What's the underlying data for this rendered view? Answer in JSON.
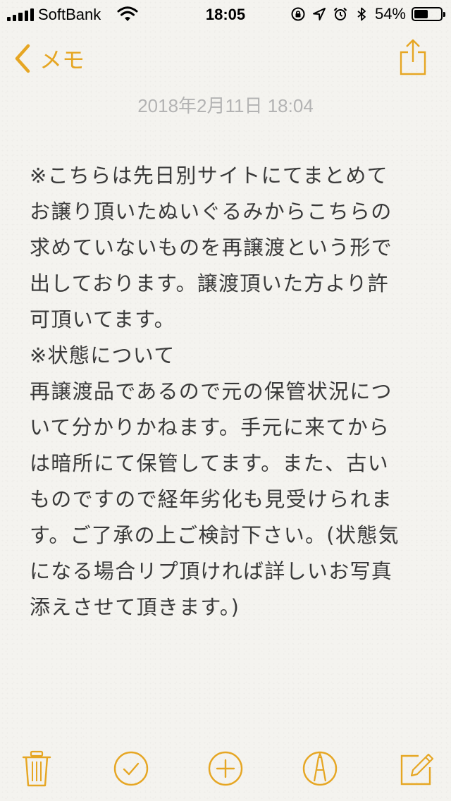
{
  "status_bar": {
    "carrier": "SoftBank",
    "time": "18:05",
    "battery_percent": "54%",
    "battery_level": 0.54,
    "icons": [
      "signal-icon",
      "wifi-icon",
      "orientation-lock-icon",
      "location-icon",
      "alarm-icon",
      "bluetooth-icon",
      "battery-icon"
    ]
  },
  "nav": {
    "back_label": "メモ",
    "back_icon": "chevron-left-icon",
    "share_icon": "share-icon"
  },
  "note": {
    "date": "2018年2月11日 18:04",
    "lines": [
      "※こちらは先日別サイトにてまとめて",
      "お譲り頂いたぬいぐるみからこちらの",
      "求めていないものを再譲渡という形で",
      "出しております。譲渡頂いた方より許",
      "可頂いてます。",
      "※状態について",
      "再譲渡品であるので元の保管状況につ",
      "いて分かりかねます。手元に来てから",
      "は暗所にて保管してます。また、古い",
      "ものですので経年劣化も見受けられま",
      "す。ご了承の上ご検討下さい。(状態気",
      "になる場合リプ頂ければ詳しいお写真",
      "添えさせて頂きます。)"
    ]
  },
  "toolbar": {
    "items": [
      "trash-icon",
      "checklist-icon",
      "add-icon",
      "markup-icon",
      "compose-icon"
    ]
  },
  "colors": {
    "accent": "#e6a623",
    "text": "#3a3a3a",
    "date": "#b3b3b3",
    "background": "#f4f3ef"
  }
}
